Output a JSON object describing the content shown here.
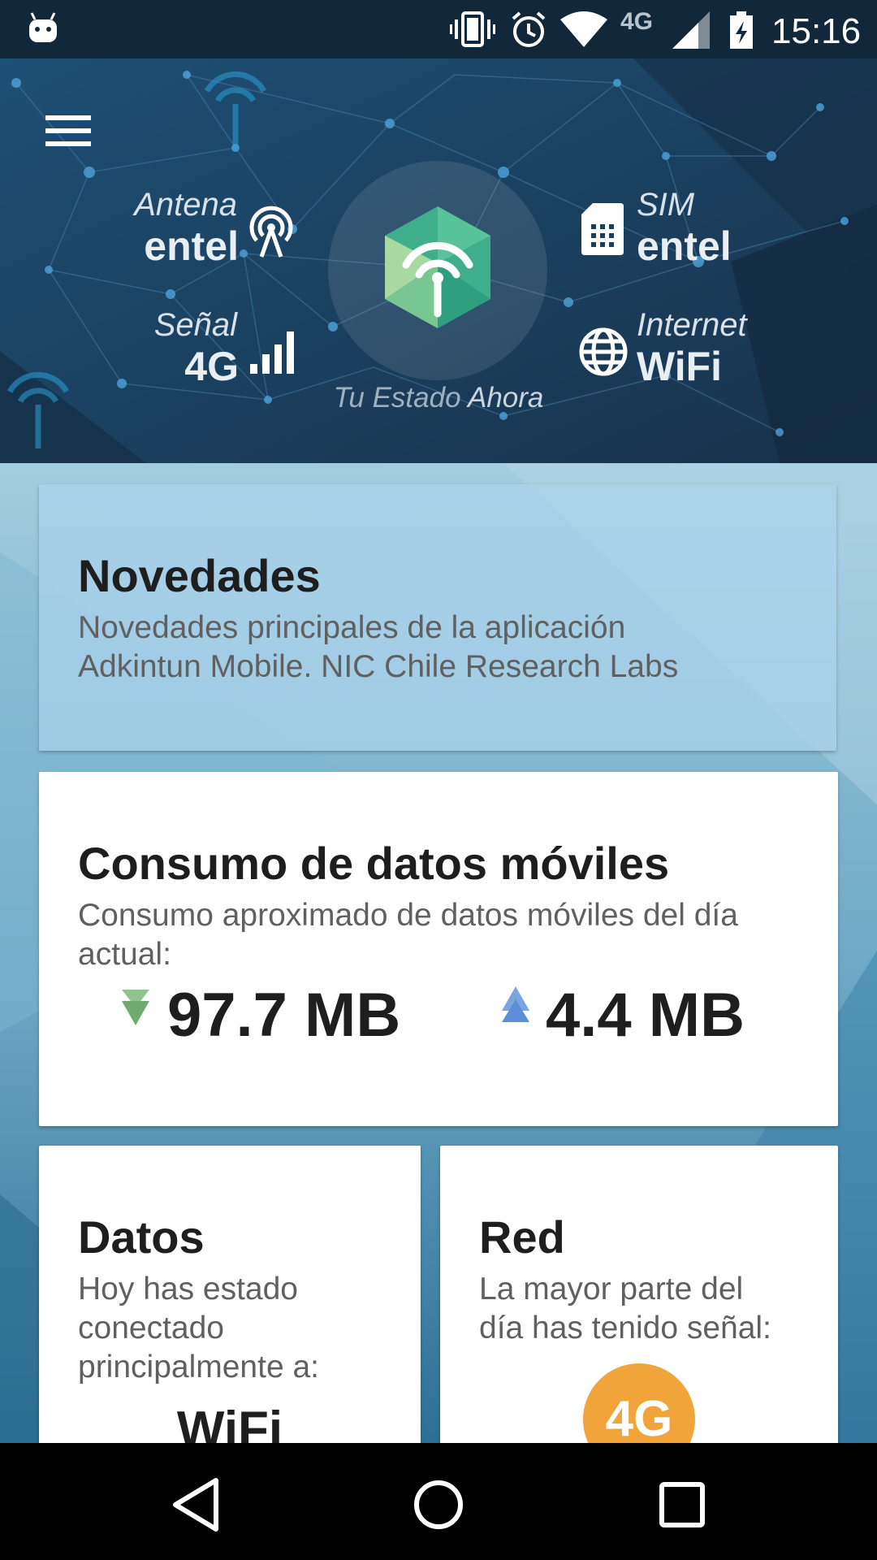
{
  "status_bar": {
    "network_type": "4G",
    "time": "15:16",
    "icons": [
      "android-icon",
      "vibrate-icon",
      "alarm-icon",
      "wifi-icon",
      "signal-icon",
      "battery-charging-icon"
    ]
  },
  "header": {
    "antena": {
      "label": "Antena",
      "value": "entel",
      "icon": "antenna-icon"
    },
    "senal": {
      "label": "Señal",
      "value": "4G",
      "icon": "signal-bars-icon"
    },
    "sim": {
      "label": "SIM",
      "value": "entel",
      "icon": "sim-card-icon"
    },
    "internet": {
      "label": "Internet",
      "value": "WiFi",
      "icon": "globe-icon"
    },
    "caption_prefix": "Tu Estado",
    "caption_emphasis": "Ahora",
    "center_icon": "app-logo-icon"
  },
  "cards": {
    "novedades": {
      "title": "Novedades",
      "line1": "Novedades principales de la aplicación",
      "line2": "Adkintun Mobile. NIC Chile Research Labs"
    },
    "consumo": {
      "title": "Consumo de datos móviles",
      "line1": "Consumo aproximado de datos móviles del día",
      "line2": "actual:",
      "download": "97.7 MB",
      "upload": "4.4 MB"
    },
    "datos": {
      "title": "Datos",
      "line1": "Hoy has estado",
      "line2": "conectado",
      "line3": "principalmente a:",
      "value": "WiFi"
    },
    "red": {
      "title": "Red",
      "line1": "La mayor parte del",
      "line2": "día has tenido señal:",
      "badge": "4G"
    }
  },
  "colors": {
    "header_bg": "#1a3f5e",
    "logo_green": "#3fae8a",
    "download_arrow": "#6fab6f",
    "upload_arrow": "#5b8fd6",
    "badge_orange": "#f0a43a"
  }
}
